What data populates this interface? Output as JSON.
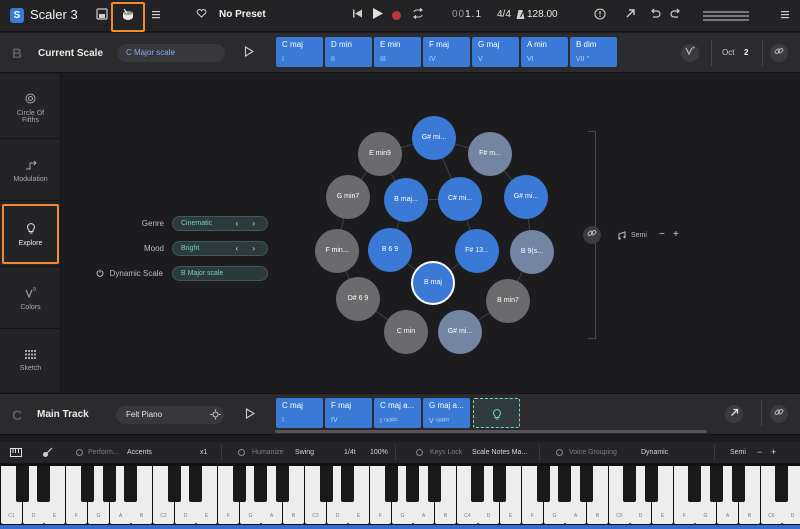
{
  "app": {
    "logo_letter": "S",
    "title": "Scaler 3"
  },
  "topbar": {
    "preset_icon": "heart-icon",
    "preset_name": "No Preset",
    "position_dim": "00",
    "position_main": "1.1",
    "time_signature": "4/4",
    "tempo": "128.00"
  },
  "scale": {
    "letter": "B",
    "label": "Current Scale",
    "selected": "C Major scale",
    "chords": [
      {
        "name": "C maj",
        "degree": "I"
      },
      {
        "name": "D min",
        "degree": "II"
      },
      {
        "name": "E min",
        "degree": "III"
      },
      {
        "name": "F maj",
        "degree": "IV"
      },
      {
        "name": "G maj",
        "degree": "V"
      },
      {
        "name": "A min",
        "degree": "VI"
      },
      {
        "name": "B dim",
        "degree": "VII °"
      }
    ],
    "octave_label": "Oct",
    "octave_value": "2"
  },
  "sidebar": {
    "items": [
      {
        "label": "Circle Of Fifths",
        "icon": "target-icon"
      },
      {
        "label": "Modulation",
        "icon": "modulation-icon"
      },
      {
        "label": "Explore",
        "icon": "lightbulb-icon"
      },
      {
        "label": "Colors",
        "icon": "colors-icon"
      },
      {
        "label": "Sketch",
        "icon": "grid-icon"
      }
    ]
  },
  "explore": {
    "genre_label": "Genre",
    "genre_value": "Cinematic",
    "mood_label": "Mood",
    "mood_value": "Bright",
    "dynamic_label": "Dynamic Scale",
    "dynamic_value": "B Major scale",
    "semi_label": "Semi",
    "semi_minus": "−",
    "semi_plus": "+",
    "nodes": [
      {
        "label": "G# mi...",
        "style": "blue"
      },
      {
        "label": "E min9",
        "style": "gray"
      },
      {
        "label": "F# m...",
        "style": "slate"
      },
      {
        "label": "G min7",
        "style": "gray"
      },
      {
        "label": "B maj...",
        "style": "blue"
      },
      {
        "label": "C# mi...",
        "style": "blue"
      },
      {
        "label": "G# mi...",
        "style": "blue"
      },
      {
        "label": "F min...",
        "style": "gray"
      },
      {
        "label": "B 6 9",
        "style": "blue"
      },
      {
        "label": "F# 13...",
        "style": "blue"
      },
      {
        "label": "B 9(s...",
        "style": "slate"
      },
      {
        "label": "B maj",
        "style": "active"
      },
      {
        "label": "D# 6 9",
        "style": "gray"
      },
      {
        "label": "B min7",
        "style": "gray"
      },
      {
        "label": "C min",
        "style": "gray"
      },
      {
        "label": "G# mi...",
        "style": "slate"
      }
    ]
  },
  "track": {
    "letter": "C",
    "label": "Main Track",
    "instrument": "Felt Piano",
    "chords": [
      {
        "name": "C maj",
        "degree": "I"
      },
      {
        "name": "F maj",
        "degree": "IV"
      },
      {
        "name": "C maj a...",
        "degree": "I ⁽ᵃᵈᵈ²⁾"
      },
      {
        "name": "G maj a...",
        "degree": "V ⁽ᵃᵈᵈ²⁾"
      }
    ]
  },
  "options": {
    "perform_label": "Perform...",
    "perform_value": "Accents",
    "perform_mult": "x1",
    "humanize_label": "Humanize",
    "humanize_value": "Swing",
    "humanize_div": "1/4t",
    "humanize_pct": "100%",
    "keys_lock_label": "Keys Lock",
    "keys_lock_value": "Scale Notes Ma...",
    "voice_label": "Voice Grouping",
    "voice_value": "Dynamic",
    "semi_label": "Semi",
    "semi_minus": "−",
    "semi_plus": "+"
  },
  "keyboard": {
    "white_labels": [
      "C1",
      "D",
      "E",
      "F",
      "G",
      "A",
      "B",
      "C2",
      "D",
      "E",
      "F",
      "G",
      "A",
      "B",
      "C3",
      "D",
      "E",
      "F",
      "G",
      "A",
      "B",
      "C4",
      "D",
      "E",
      "F",
      "G",
      "A",
      "B",
      "C5",
      "D",
      "E",
      "F",
      "G",
      "A",
      "B",
      "C6",
      "D"
    ]
  },
  "colors": {
    "accent_blue": "#3a79d6",
    "highlight_orange": "#f28a2e",
    "teal": "#6fd0c8"
  }
}
